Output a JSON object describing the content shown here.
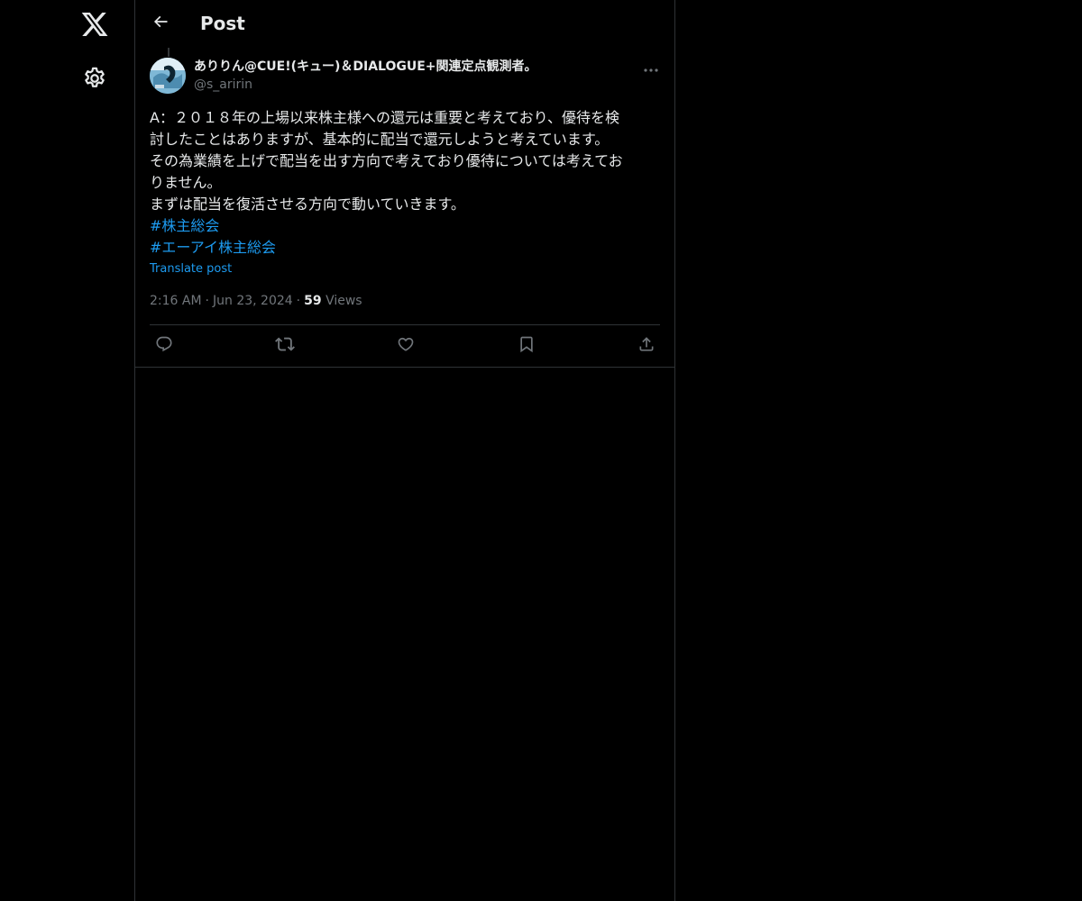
{
  "nav": {
    "logo_icon": "x-logo-icon",
    "settings_icon": "gear-icon"
  },
  "header": {
    "back_icon": "arrow-left-icon",
    "title": "Post"
  },
  "tweet": {
    "author": {
      "display_name": "ありりん@CUE!(キュー)＆DIALOGUE+関連定点観測者。",
      "handle": "@s_aririn"
    },
    "body_lines": [
      "A：２０１８年の上場以来株主様への還元は重要と考えており、優待を検",
      "討したことはありますが、基本的に配当で還元しようと考えています。",
      "その為業績を上げで配当を出す方向で考えており優待については考えてお",
      "りません。",
      "まずは配当を復活させる方向で動いていきます。"
    ],
    "hashtags": [
      "#株主総会",
      "#エーアイ株主総会"
    ],
    "translate_label": "Translate post",
    "time": "2:16 AM",
    "date": "Jun 23, 2024",
    "views_count": "59",
    "views_label": "Views",
    "separator": "·"
  },
  "actions": {
    "reply_icon": "reply-icon",
    "repost_icon": "repost-icon",
    "like_icon": "heart-icon",
    "bookmark_icon": "bookmark-icon",
    "share_icon": "share-icon"
  },
  "colors": {
    "background": "#000000",
    "text": "#e7e9ea",
    "secondary": "#71767b",
    "accent": "#1d9bf0",
    "border": "#2f3336"
  }
}
